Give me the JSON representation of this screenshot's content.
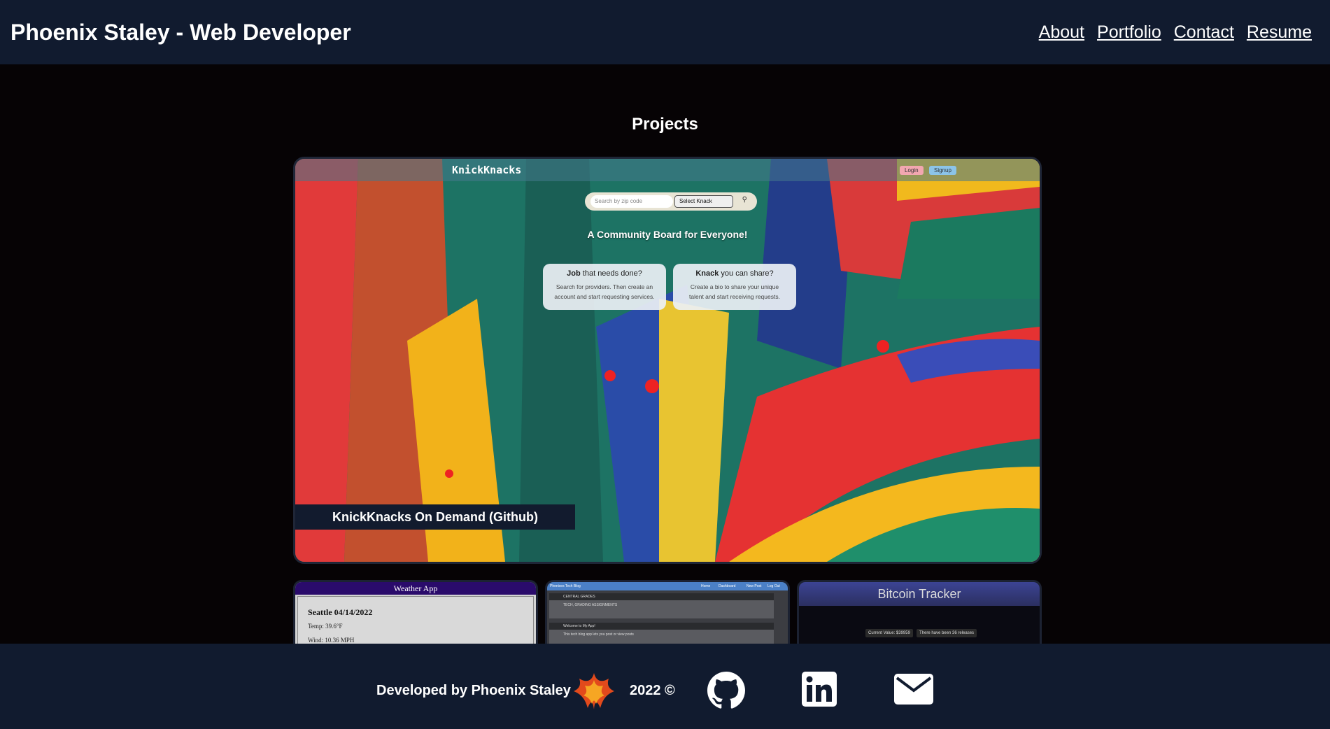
{
  "header": {
    "title": "Phoenix Staley - Web Developer",
    "nav": [
      "About",
      "Portfolio",
      "Contact",
      "Resume"
    ]
  },
  "main": {
    "heading": "Projects",
    "featured": {
      "caption": "KnickKnacks On Demand (Github)",
      "screenshot": {
        "logo": "KnickKnacks",
        "login": "Login",
        "signup": "Signup",
        "search_placeholder": "Search by zip code",
        "select_value": "Select Knack",
        "tagline": "A Community Board for Everyone!",
        "card1": {
          "bold": "Job",
          "rest": " that needs done?",
          "desc1": "Search for providers. Then create an",
          "desc2": "account and start requesting services."
        },
        "card2": {
          "bold": "Knack",
          "rest": " you can share?",
          "desc1": "Create a bio to share your unique",
          "desc2": "talent and start receiving requests."
        }
      }
    },
    "thumbnails": {
      "weather": {
        "title": "Weather App",
        "city": "Seattle 04/14/2022",
        "temp": "Temp: 39.6°F",
        "wind": "Wind: 10.36 MPH"
      },
      "blog": {
        "site": "Phenixes Tech Blog",
        "nav": [
          "Home",
          "Dashboard",
          "New Post",
          "Log Out"
        ],
        "post1_title": "CENTRAL GRADES",
        "post1_body": "TECH, GRADING ASSIGNMENTS",
        "post2_title": "Welcome to My App!",
        "post2_body": "This tech blog app lets you post or view posts"
      },
      "bitcoin": {
        "title": "Bitcoin Tracker",
        "value": "Current Value: $39959",
        "releases": "There have been 36 releases"
      }
    }
  },
  "footer": {
    "developed_by": "Developed by Phoenix Staley",
    "year": "2022 ©",
    "icons": [
      "phoenix-logo",
      "github-icon",
      "linkedin-icon",
      "mail-icon"
    ]
  },
  "colors": {
    "header_bg": "#111b2f",
    "page_bg": "#060305",
    "text": "#ffffff"
  }
}
